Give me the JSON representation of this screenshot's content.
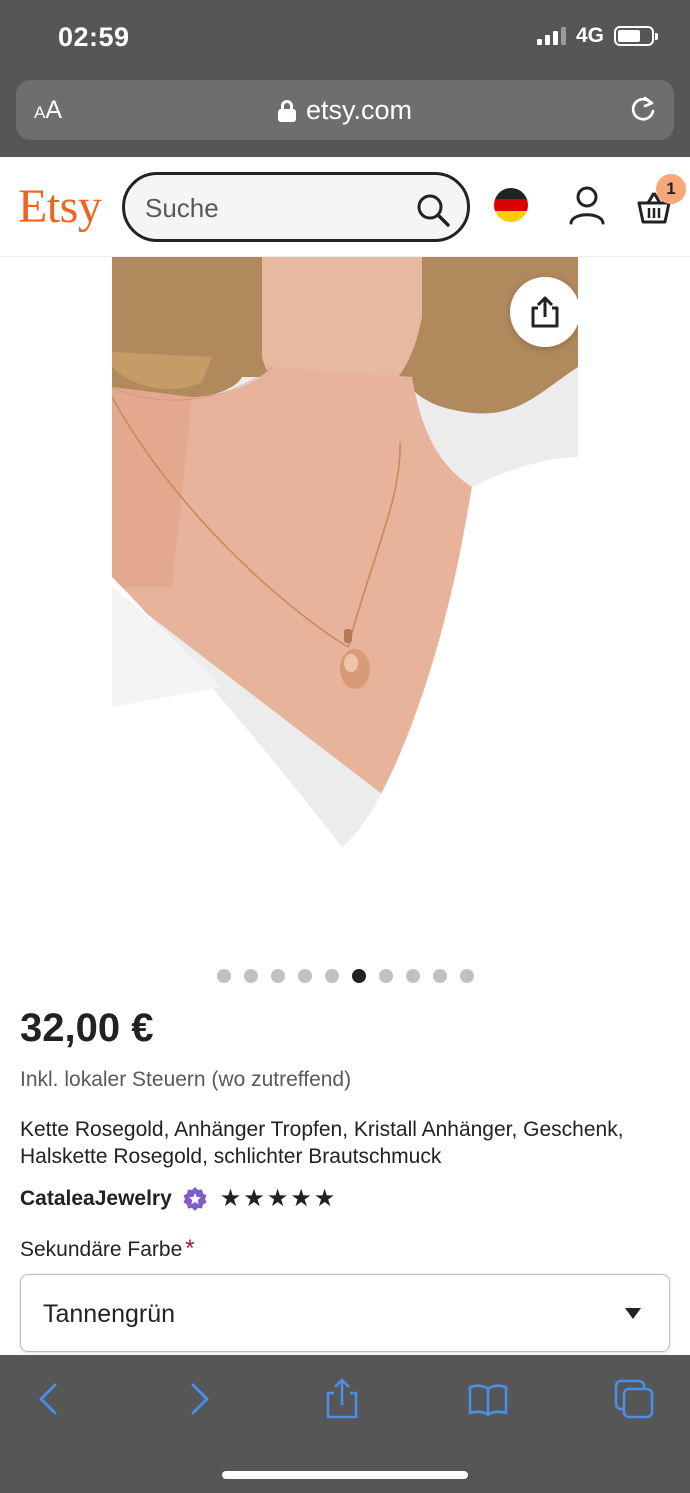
{
  "status_bar": {
    "time": "02:59",
    "network": "4G"
  },
  "browser": {
    "aa_label_small": "A",
    "aa_label": "A",
    "url": "etsy.com"
  },
  "header": {
    "logo": "Etsy",
    "search_placeholder": "Suche",
    "cart_count": "1",
    "brand_color": "#f1641e"
  },
  "product": {
    "image_dots_total": 10,
    "image_dots_active_index": 5,
    "price": "32,00 €",
    "tax_note": "Inkl. lokaler Steuern (wo zutreffend)",
    "title": "Kette Rosegold, Anhänger Tropfen, Kristall Anhänger, Geschenk, Halskette Rosegold, schlichter Brautschmuck",
    "seller": "CataleaJewelry",
    "rating_stars": 5,
    "star_glyph": "★",
    "option_label": "Sekundäre Farbe",
    "required_mark": "*",
    "selected_option": "Tannengrün"
  }
}
